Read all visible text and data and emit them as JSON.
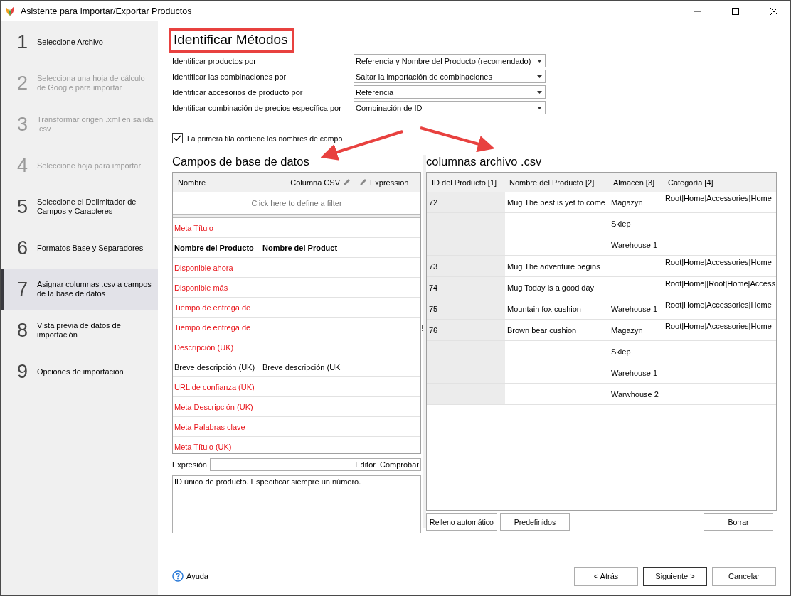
{
  "window": {
    "title": "Asistente para Importar/Exportar Productos"
  },
  "sidebar": {
    "steps": [
      {
        "number": "1",
        "label": "Seleccione Archivo",
        "selected": false,
        "disabled": false
      },
      {
        "number": "2",
        "label": "Selecciona una hoja de cálculo de Google para importar",
        "selected": false,
        "disabled": true
      },
      {
        "number": "3",
        "label": "Transformar origen .xml en salida .csv",
        "selected": false,
        "disabled": true
      },
      {
        "number": "4",
        "label": "Seleccione hoja para importar",
        "selected": false,
        "disabled": true
      },
      {
        "number": "5",
        "label": "Seleccione el Delimitador de Campos y Caracteres",
        "selected": false,
        "disabled": false
      },
      {
        "number": "6",
        "label": "Formatos Base y Separadores",
        "selected": false,
        "disabled": false
      },
      {
        "number": "7",
        "label": "Asignar columnas .csv a campos de la base de datos",
        "selected": true,
        "disabled": false
      },
      {
        "number": "8",
        "label": "Vista previa de datos de importación",
        "selected": false,
        "disabled": false
      },
      {
        "number": "9",
        "label": "Opciones de importación",
        "selected": false,
        "disabled": false
      }
    ]
  },
  "heading": {
    "text": "Identificar Métodos",
    "highlighted": true
  },
  "identify": [
    {
      "label": "Identificar productos por",
      "value": "Referencia y Nombre del Producto (recomendado)"
    },
    {
      "label": "Identificar las combinaciones por",
      "value": "Saltar la importación de combinaciones"
    },
    {
      "label": "Identificar accesorios de producto por",
      "value": "Referencia"
    },
    {
      "label": "Identificar combinación de precios específica por",
      "value": "Combinación de ID"
    }
  ],
  "header_row_checkbox": {
    "label": "La primera fila contiene los nombres de campo",
    "checked": true
  },
  "db_fields": {
    "title": "Campos de base de datos",
    "columns": [
      "Nombre",
      "Columna CSV",
      "Expression"
    ],
    "filter_hint": "Click here to define a filter",
    "rows": [
      {
        "name": "Meta Título",
        "unmapped": true,
        "key": false
      },
      {
        "name": "Nombre del Producto",
        "csv_column": "Nombre del Product",
        "unmapped": false,
        "key": true
      },
      {
        "name": "Disponible ahora",
        "unmapped": true,
        "key": false
      },
      {
        "name": "Disponible más",
        "unmapped": true,
        "key": false
      },
      {
        "name": "Tiempo de entrega de",
        "unmapped": true,
        "key": false
      },
      {
        "name": "Tiempo de entrega de",
        "unmapped": true,
        "key": false
      },
      {
        "name": "Descripción (UK)",
        "unmapped": true,
        "key": false
      },
      {
        "name": "Breve descripción (UK)",
        "csv_column": "Breve descripción (UK",
        "unmapped": false,
        "key": false
      },
      {
        "name": "URL de confianza (UK)",
        "unmapped": true,
        "key": false
      },
      {
        "name": "Meta Descripción (UK)",
        "unmapped": true,
        "key": false
      },
      {
        "name": "Meta Palabras clave",
        "unmapped": true,
        "key": false
      },
      {
        "name": "Meta Título (UK)",
        "unmapped": true,
        "key": false
      }
    ]
  },
  "expression": {
    "label": "Expresión",
    "buttons": [
      "Editor",
      "Comprobar"
    ],
    "description": "ID único de producto. Especificar siempre un número."
  },
  "csv": {
    "title": "columnas archivo .csv",
    "columns": [
      "ID del Producto [1]",
      "Nombre del Producto [2]",
      "Almacén [3]",
      "Categoría [4]"
    ],
    "rows": [
      {
        "id": "72",
        "name": "Mug The best is yet to come",
        "warehouse": "Magazyn",
        "category": "Root|Home|Accessories|Home"
      },
      {
        "warehouse": "Sklep"
      },
      {
        "warehouse": "Warehouse 1"
      },
      {
        "id": "73",
        "name": "Mug The adventure begins",
        "category": "Root|Home|Accessories|Home"
      },
      {
        "id": "74",
        "name": "Mug Today is a good day",
        "category": "Root|Home||Root|Home|Access"
      },
      {
        "id": "75",
        "name": "Mountain fox cushion",
        "warehouse": "Warehouse 1",
        "category": "Root|Home|Accessories|Home"
      },
      {
        "id": "76",
        "name": "Brown bear cushion",
        "warehouse": "Magazyn",
        "category": "Root|Home|Accessories|Home"
      },
      {
        "warehouse": "Sklep"
      },
      {
        "warehouse": "Warehouse 1"
      },
      {
        "warehouse": "Warwhouse 2"
      }
    ],
    "buttons": [
      "Relleno automático",
      "Predefinidos"
    ],
    "clear_button": "Borrar"
  },
  "footer": {
    "help": "Ayuda",
    "buttons": [
      {
        "label": "< Atrás",
        "default": false
      },
      {
        "label": "Siguiente >",
        "default": true
      },
      {
        "label": "Cancelar",
        "default": false
      }
    ]
  }
}
